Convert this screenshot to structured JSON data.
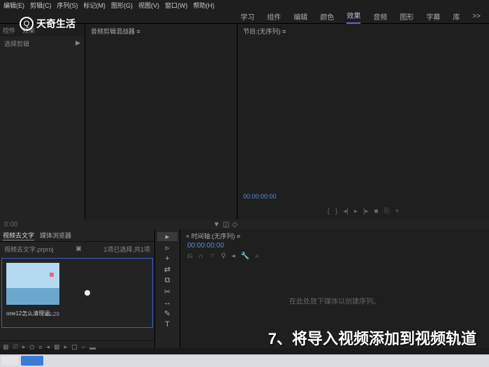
{
  "menu": [
    "编辑(E)",
    "剪辑(C)",
    "序列(S)",
    "标记(M)",
    "图形(G)",
    "视图(V)",
    "窗口(W)",
    "帮助(H)"
  ],
  "logo": "天奇生活",
  "workspace": {
    "tabs": [
      "学习",
      "组件",
      "编辑",
      "颜色",
      "效果",
      "音频",
      "图形",
      "字幕",
      "库"
    ],
    "active": 4,
    "more": ">>"
  },
  "leftPanel": {
    "tab1": "控件",
    "tab2": "效果",
    "sub": "选择剪辑",
    "arrow": "▶"
  },
  "centerPanel": {
    "title": "音频剪辑混战器 ≡"
  },
  "programPanel": {
    "title": "节目:(无序列) ≡",
    "timecode": "00:00:00:00"
  },
  "midRow": {
    "tc": "0:00"
  },
  "project": {
    "tab1": "视频去文字",
    "tab2": "媒体浏览器",
    "filename": "视频去文字.prproj",
    "status": "1项已选择,共1项",
    "thumbLabel": "one12怎么清理运...",
    "thumbDur": "41:29",
    "footer": [
      "▦",
      "⎚",
      "▸",
      "O",
      "≡",
      "◂",
      "▦",
      "▸",
      "口",
      "⌕",
      "▬",
      "▬"
    ]
  },
  "tools": [
    "▸",
    "▹",
    "+",
    "⇄",
    "⧉",
    "✂",
    "↔",
    "✎",
    "T"
  ],
  "timeline": {
    "tab": "× 时间轴:(无序列) ≡",
    "tc": "00:00:00:00",
    "icons": [
      "⎌",
      "∩",
      "☞",
      "⚲",
      "◂",
      "🔧",
      "⌕"
    ],
    "dropText": "在此处放下媒体以创建序列。"
  },
  "caption": "7、将导入视频添加到视频轨道"
}
